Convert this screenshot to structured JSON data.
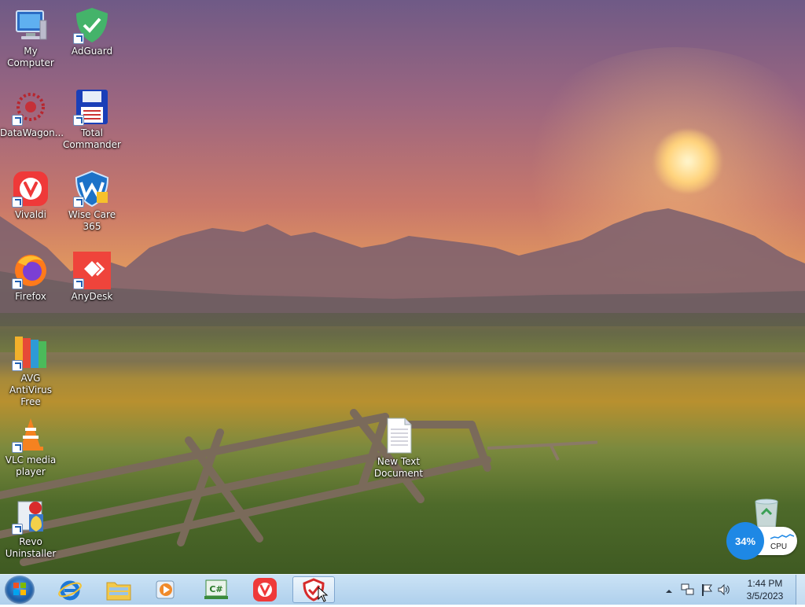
{
  "desktop": {
    "icons": [
      {
        "label": "My Computer",
        "icon": "computer-icon"
      },
      {
        "label": "AdGuard",
        "icon": "adguard-icon"
      },
      {
        "label": "DataWagon...",
        "icon": "datawagon-icon"
      },
      {
        "label": "Total Commander",
        "icon": "floppy-disk-icon"
      },
      {
        "label": "Vivaldi",
        "icon": "vivaldi-icon"
      },
      {
        "label": "Wise Care 365",
        "icon": "wise-care-icon"
      },
      {
        "label": "Firefox",
        "icon": "firefox-icon"
      },
      {
        "label": "AnyDesk",
        "icon": "anydesk-icon"
      },
      {
        "label": "AVG AntiVirus Free",
        "icon": "avg-icon"
      },
      {
        "label": "VLC media player",
        "icon": "vlc-cone-icon"
      },
      {
        "label": "Revo Uninstaller",
        "icon": "revo-uninstaller-icon"
      },
      {
        "label": "New Text Document",
        "icon": "text-document-icon"
      },
      {
        "label": "",
        "icon": "recycle-bin-icon"
      }
    ]
  },
  "cpu_widget": {
    "percent": "34%",
    "label": "CPU",
    "value": 0.34,
    "color": "#1e88e5"
  },
  "taskbar": {
    "buttons": [
      {
        "name": "start-button",
        "icon": "windows-orb-icon"
      },
      {
        "name": "internet-explorer",
        "icon": "ie-icon"
      },
      {
        "name": "file-explorer",
        "icon": "folder-icon"
      },
      {
        "name": "media-player",
        "icon": "media-player-icon"
      },
      {
        "name": "csharp-editor",
        "icon": "csharp-icon"
      },
      {
        "name": "vivaldi",
        "icon": "vivaldi-icon"
      },
      {
        "name": "adguard",
        "icon": "adguard-shield-icon",
        "active": true
      }
    ],
    "tray": {
      "icons": [
        "show-hidden-icon",
        "network-icon",
        "flag-icon",
        "volume-icon"
      ]
    },
    "clock": {
      "time": "1:44 PM",
      "date": "3/5/2023"
    }
  }
}
